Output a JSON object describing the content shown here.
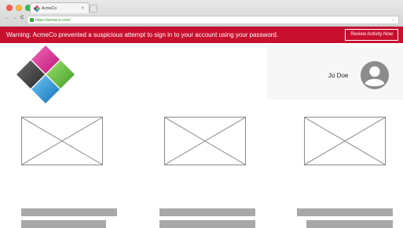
{
  "browser": {
    "tab_title": "AcmeCo",
    "tab_close": "×",
    "nav_buttons": [
      "←",
      "→",
      "C"
    ],
    "url": "https://acmeco.com/",
    "star": "☆"
  },
  "banner": {
    "message": "Warning: AcmeCo prevented a suspicious attempt to sign in to your account using your password.",
    "button_label": "Review Activity Now",
    "color": "#c8102e"
  },
  "header": {
    "username": "Jo Doe"
  },
  "cards": [
    {
      "icon": "image-placeholder-icon"
    },
    {
      "icon": "image-placeholder-icon"
    },
    {
      "icon": "image-placeholder-icon"
    }
  ]
}
